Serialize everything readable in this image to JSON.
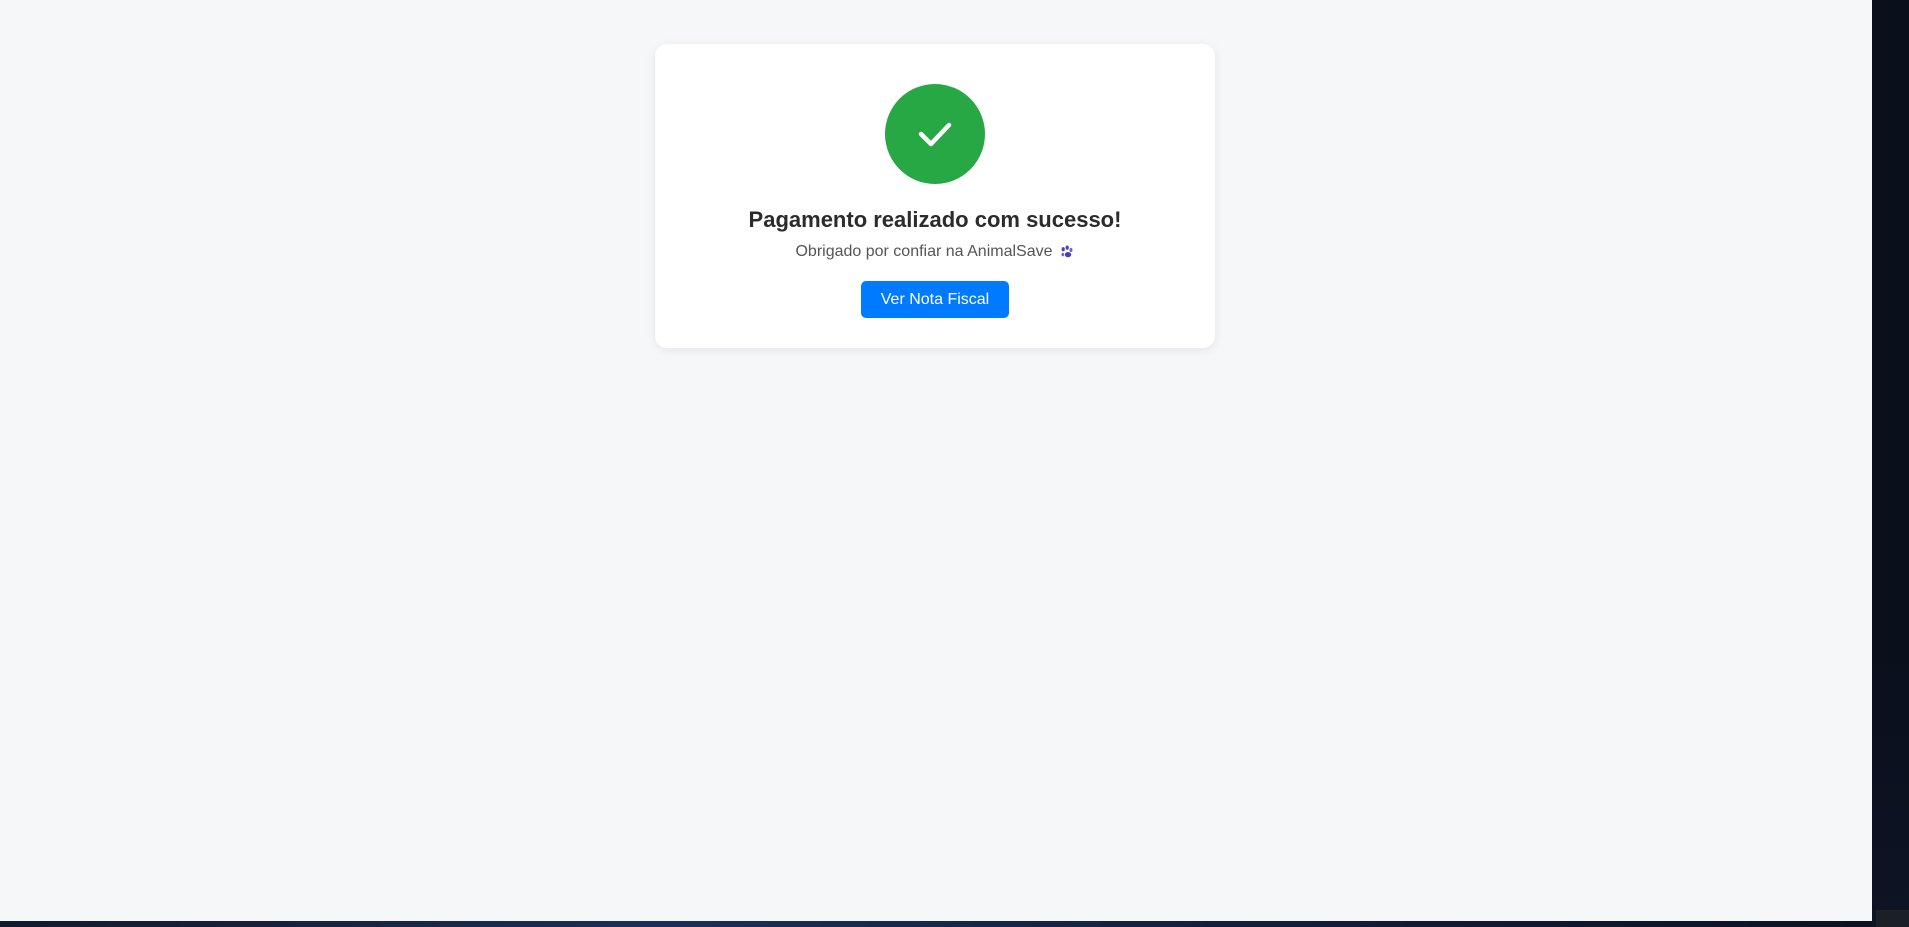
{
  "page": {
    "background_color": "#f6f7f9"
  },
  "success_card": {
    "icon": "check-icon",
    "icon_color": "#28a745",
    "title": "Pagamento realizado com sucesso!",
    "message": "Obrigado por confiar na AnimalSave",
    "message_icon": "paw-icon",
    "button_label": "Ver Nota Fiscal",
    "button_color": "#007bff"
  }
}
